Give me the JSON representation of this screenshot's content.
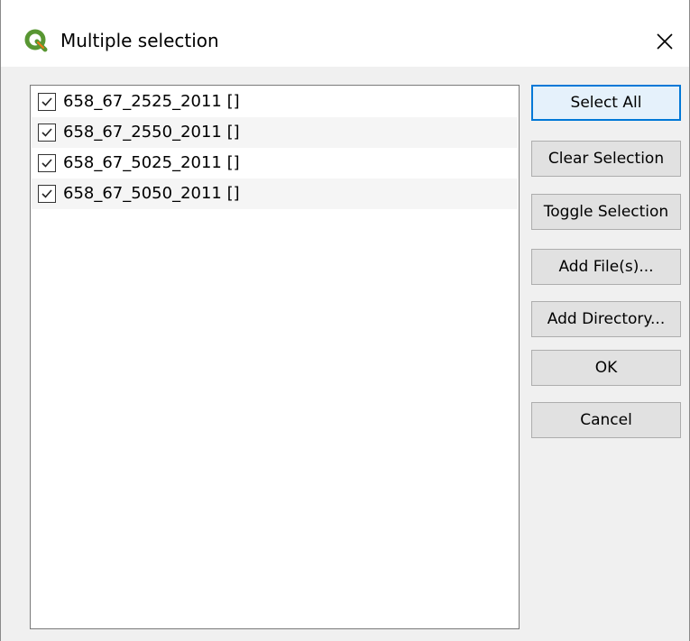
{
  "window": {
    "title": "Multiple selection",
    "logo_icon": "qgis-logo-icon",
    "close_icon": "close-icon"
  },
  "list": {
    "items": [
      {
        "label": "658_67_2525_2011 []",
        "checked": true
      },
      {
        "label": "658_67_2550_2011 []",
        "checked": true
      },
      {
        "label": "658_67_5025_2011 []",
        "checked": true
      },
      {
        "label": "658_67_5050_2011 []",
        "checked": true
      }
    ]
  },
  "buttons": {
    "select_all": "Select All",
    "clear_selection": "Clear Selection",
    "toggle_selection": "Toggle Selection",
    "add_files": "Add File(s)...",
    "add_directory": "Add Directory...",
    "ok": "OK",
    "cancel": "Cancel"
  },
  "colors": {
    "accent": "#0078d7",
    "qgis_green": "#589632",
    "qgis_yellow": "#ee7913"
  }
}
